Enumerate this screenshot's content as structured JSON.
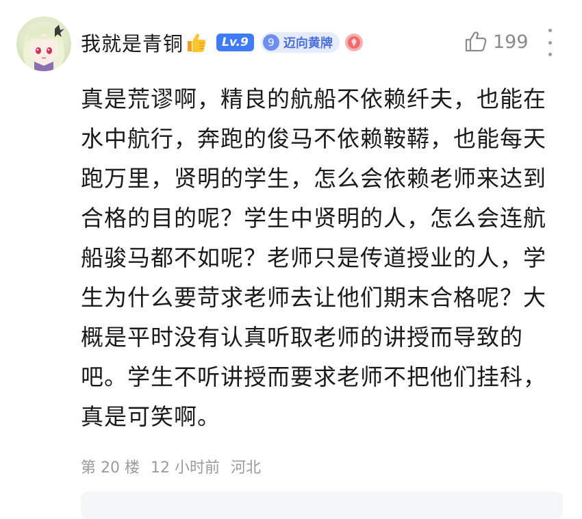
{
  "comment": {
    "username": "我就是青铜",
    "level_badge": "Lv.9",
    "medal_number": "9",
    "medal_label": "迈向黄牌",
    "like_count": "199",
    "content": "真是荒谬啊，精良的航船不依赖纤夫，也能在水中航行，奔跑的俊马不依赖鞍鞯，也能每天跑万里，贤明的学生，怎么会依赖老师来达到合格的目的呢？学生中贤明的人，怎么会连航船骏马都不如呢？老师只是传道授业的人，学生为什么要苛求老师去让他们期末合格呢？大概是平时没有认真听取老师的讲授而导致的吧。学生不听讲授而要求老师不把他们挂科，真是可笑啊。",
    "floor": "第 20 楼",
    "time": "12 小时前",
    "location": "河北"
  },
  "colors": {
    "level_badge": "#3d7cf5",
    "medal_bg": "#e6ecfc",
    "medal_text": "#4b6fe0",
    "meta_text": "#9a9a9a"
  },
  "icons": {
    "avatar": "anime-avatar",
    "emoji": "thumbs-up-emoji",
    "gem": "pink-gem-icon",
    "like": "thumbs-up-icon",
    "more": "more-vertical-icon"
  }
}
